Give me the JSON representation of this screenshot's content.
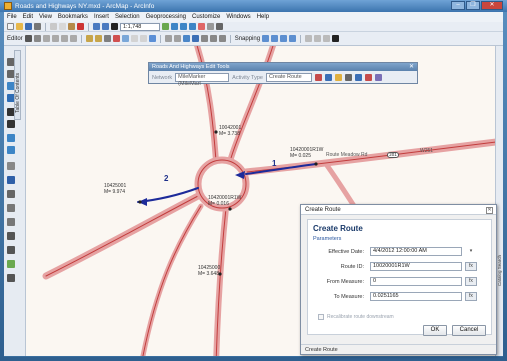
{
  "window": {
    "title": "Roads and Highways NY.mxd - ArcMap - ArcInfo",
    "buttons": [
      "–",
      "❐",
      "✕"
    ]
  },
  "menu": [
    "File",
    "Edit",
    "View",
    "Bookmarks",
    "Insert",
    "Selection",
    "Geoprocessing",
    "Customize",
    "Windows",
    "Help"
  ],
  "toolbar": {
    "scale": "1:1,748",
    "editor_label": "Editor",
    "snapping_label": "Snapping"
  },
  "toc_tab": "Table Of Contents",
  "right_tab": "Catalog  Search",
  "edit_tools": {
    "title": "Roads And Highways Edit Tools",
    "network_label": "Network",
    "network_value": "MileMarker (MileMarl",
    "activity_label": "Activity Type",
    "activity_value": "Create Route"
  },
  "map": {
    "labels": [
      {
        "id": "1042001",
        "text": "10042001",
        "measure": "M= 3.738"
      },
      {
        "id": "1042010",
        "text": "10420001R1W",
        "measure": "M= 0.025"
      },
      {
        "id": "10425001",
        "text": "10425001",
        "measure": "M= 9.974"
      },
      {
        "id": "10420001",
        "text": "10420001R1W",
        "measure": "M= 0.016"
      },
      {
        "id": "10425000",
        "text": "10425000",
        "measure": "M= 3.648"
      }
    ],
    "road_name": "Route Meadow Rd",
    "shield_text": "201",
    "road_label_right": "W251",
    "route_numbers": [
      "1",
      "2"
    ]
  },
  "dialog": {
    "title": "Create Route",
    "heading": "Create Route",
    "section": "Parameters",
    "fields": [
      {
        "label": "Effective Date:",
        "value": "4/4/2012 12:00:00 AM",
        "button": "▾"
      },
      {
        "label": "Route ID:",
        "value": "10020001R1W",
        "button": "fx"
      },
      {
        "label": "From Measure:",
        "value": "0",
        "button": "fx"
      },
      {
        "label": "To Measure:",
        "value": "0.0251165",
        "button": "fx"
      }
    ],
    "checkbox_label": "Recalibrate route downstream",
    "ok_label": "OK",
    "cancel_label": "Cancel",
    "status": "Create Route"
  }
}
